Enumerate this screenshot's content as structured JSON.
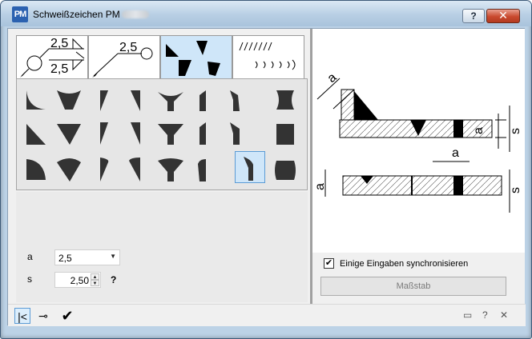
{
  "window": {
    "title": "Schweißzeichen PM",
    "app_icon_label": "PM",
    "help_button": "?",
    "close_button": "✕"
  },
  "tabs": [
    {
      "name": "tab-weld-symbol-arrow",
      "label_top": "2,5",
      "label_bottom": "2,5",
      "active": false
    },
    {
      "name": "tab-weld-symbol-circle",
      "label_top": "2,5",
      "active": false
    },
    {
      "name": "tab-weld-shapes",
      "active": true
    },
    {
      "name": "tab-weld-seam",
      "active": false
    }
  ],
  "grid": {
    "rows": 3,
    "cols": 9,
    "selected": {
      "row": 2,
      "col": 7
    }
  },
  "params": {
    "a": {
      "label": "a",
      "value": "2,5"
    },
    "s": {
      "label": "s",
      "value": "2,50",
      "help": "?"
    }
  },
  "drawing_labels": {
    "a": "a",
    "s": "s"
  },
  "sync": {
    "checked": true,
    "check_mark": "✔",
    "label": "Einige Eingaben synchronisieren"
  },
  "massstab_button": "Maßstab",
  "bottom_bar": {
    "ok": "✔",
    "minimize": "▭",
    "help": "?",
    "close": "✕"
  },
  "colors": {
    "title_gradient_top": "#dbe8f4",
    "selected": "#cfe6f9",
    "close_red": "#c94a2e"
  }
}
